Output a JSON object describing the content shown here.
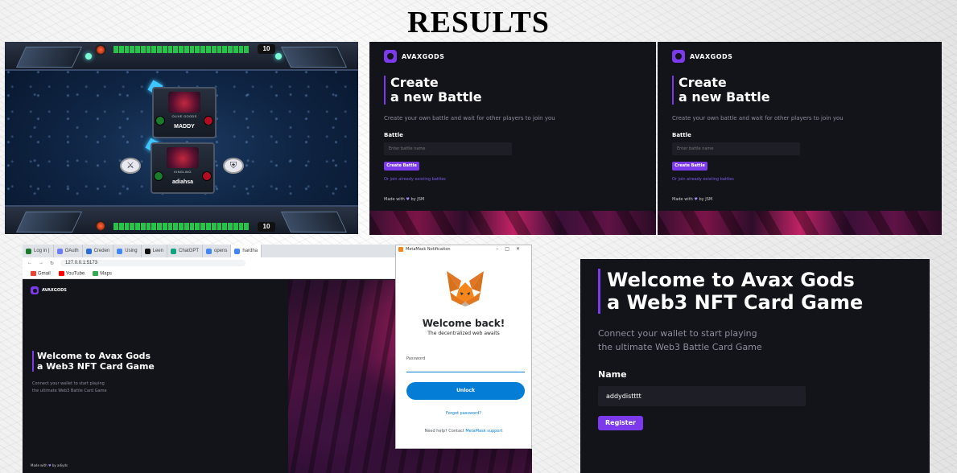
{
  "title": "RESULTS",
  "game": {
    "mana": "10",
    "player_card": {
      "name": "OLIVE GOODS",
      "player": "MADDY"
    },
    "opponent_card": {
      "name": "KINGLING",
      "player": "adiahsa"
    },
    "attack_icon": "swords-icon",
    "defend_icon": "shield-icon"
  },
  "battle": {
    "brand": "AVAXGODS",
    "heading_line1": "Create",
    "heading_line2": "a new Battle",
    "subtitle": "Create your own battle and wait for other players to join you",
    "field_label": "Battle",
    "field_placeholder": "Enter battle name",
    "button": "Create Battle",
    "link": "Or join already existing battles",
    "made_with": "Made with",
    "made_by": "by JSM"
  },
  "browser": {
    "tabs": [
      "Log in |",
      "OAuth",
      "Creden",
      "Using",
      "Leen",
      "ChatGPT",
      "opens",
      "hardha"
    ],
    "url": "127.0.0.1:5173",
    "bookmarks": [
      "Gmail",
      "YouTube",
      "Maps"
    ],
    "site": {
      "brand": "AVAXGODS",
      "heading_line1": "Welcome to Avax Gods",
      "heading_line2": "a Web3 NFT Card Game",
      "sub_line1": "Connect your wallet to start playing",
      "sub_line2": "the ultimate Web3 Battle Card Game",
      "made_with": "Made with",
      "made_by": "by adiyds"
    }
  },
  "metamask": {
    "window_title": "MetaMask Notification",
    "welcome": "Welcome back!",
    "tagline": "The decentralized web awaits",
    "password_label": "Password",
    "unlock": "Unlock",
    "forgot": "Forgot password?",
    "help_prefix": "Need help? Contact",
    "help_link": "MetaMask support"
  },
  "register": {
    "heading_line1": "Welcome to Avax Gods",
    "heading_line2": "a Web3 NFT Card Game",
    "sub_line1": "Connect your wallet to start playing",
    "sub_line2": "the ultimate Web3 Battle Card Game",
    "name_label": "Name",
    "name_value": "addydistttt",
    "button": "Register"
  },
  "colors": {
    "accent": "#7c3aed",
    "dark_bg": "#13131a",
    "metamask_blue": "#037dd6"
  }
}
